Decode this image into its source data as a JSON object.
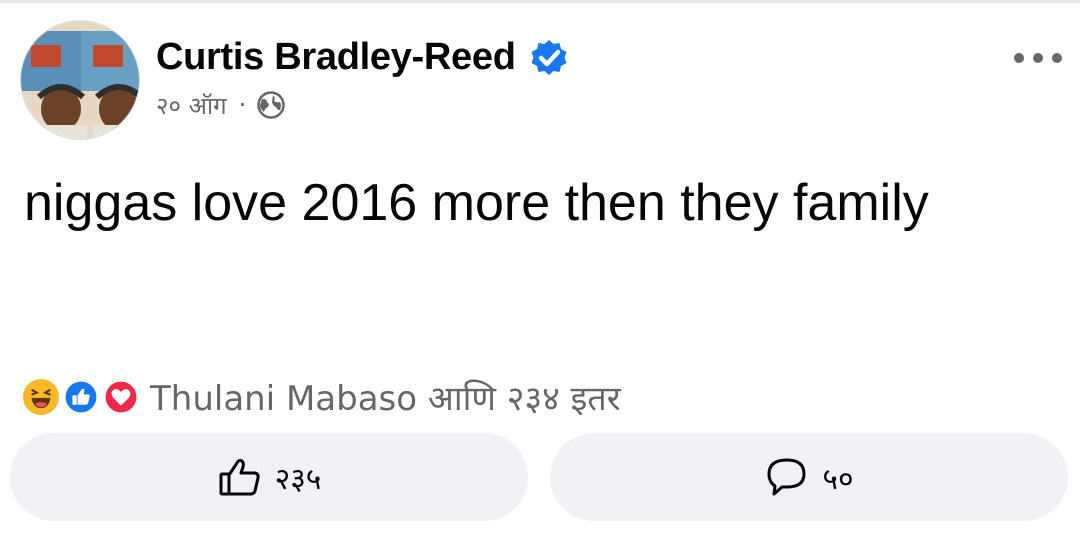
{
  "post": {
    "author_name": "Curtis Bradley-Reed",
    "timestamp": "२० ऑग",
    "separator": "·",
    "privacy_icon": "globe-icon",
    "verified_icon": "verified-badge-icon",
    "more_icon": "more-options-icon",
    "text": "niggas love 2016 more then they family"
  },
  "reactions": {
    "icons": [
      "haha-icon",
      "like-icon",
      "love-icon"
    ],
    "summary": "Thulani Mabaso आणि २३४ इतर"
  },
  "actions": {
    "like_count": "२३५",
    "comment_count": "५०",
    "like_icon": "thumbs-up-icon",
    "comment_icon": "comment-icon"
  },
  "colors": {
    "verified_blue": "#1877f2",
    "like_blue": "#1877f2",
    "love_red": "#f02849",
    "haha_yellow": "#f7b928",
    "button_bg": "#f0f2f5",
    "secondary_text": "#65676b"
  }
}
